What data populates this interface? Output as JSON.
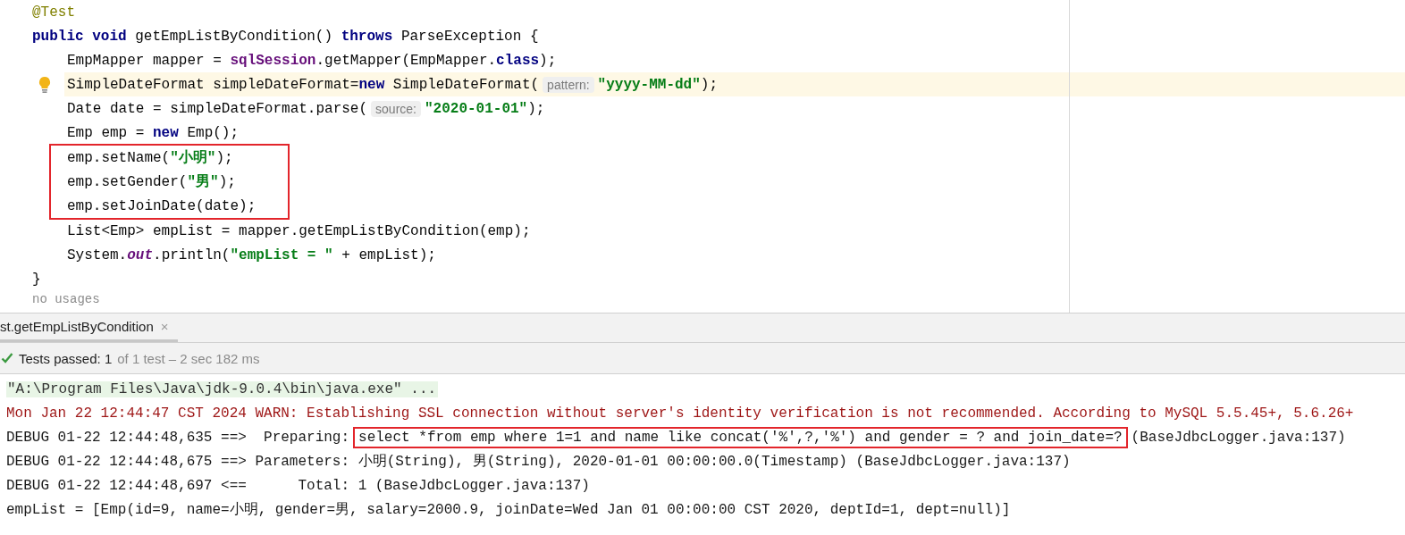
{
  "editor": {
    "lines": [
      {
        "segments": [
          {
            "kind": "annotation",
            "text": "@Test"
          }
        ]
      },
      {
        "segments": [
          {
            "kind": "keyword",
            "text": "public void "
          },
          {
            "kind": "plain",
            "text": "getEmpListByCondition() "
          },
          {
            "kind": "keyword",
            "text": "throws "
          },
          {
            "kind": "plain",
            "text": "ParseException {"
          }
        ],
        "children": [
          {
            "segments": [
              {
                "kind": "plain",
                "text": "EmpMapper mapper = "
              },
              {
                "kind": "field",
                "text": "sqlSession"
              },
              {
                "kind": "plain",
                "text": ".getMapper(EmpMapper."
              },
              {
                "kind": "keyword",
                "text": "class"
              },
              {
                "kind": "plain",
                "text": ");"
              }
            ]
          },
          {
            "current": true,
            "segments": [
              {
                "kind": "plain",
                "text": "SimpleDateFormat simpleDateFormat="
              },
              {
                "kind": "keyword",
                "text": "new "
              },
              {
                "kind": "plain",
                "text": "SimpleDateFormat("
              },
              {
                "kind": "hint",
                "text": "pattern:"
              },
              {
                "kind": "string",
                "text": "\"yyyy-MM-dd\""
              },
              {
                "kind": "plain",
                "text": ");"
              }
            ]
          },
          {
            "segments": [
              {
                "kind": "plain",
                "text": "Date date = simpleDateFormat.parse("
              },
              {
                "kind": "hint",
                "text": "source:"
              },
              {
                "kind": "string",
                "text": "\"2020-01-01\""
              },
              {
                "kind": "plain",
                "text": ");"
              }
            ]
          },
          {
            "segments": [
              {
                "kind": "plain",
                "text": "Emp emp = "
              },
              {
                "kind": "keyword",
                "text": "new "
              },
              {
                "kind": "plain",
                "text": "Emp();"
              }
            ]
          },
          {
            "kind": "boxed",
            "children": [
              {
                "segments": [
                  {
                    "kind": "plain",
                    "text": "emp.setName("
                  },
                  {
                    "kind": "string",
                    "text": "\"小明\""
                  },
                  {
                    "kind": "plain",
                    "text": ");"
                  }
                ]
              },
              {
                "segments": [
                  {
                    "kind": "plain",
                    "text": "emp.setGender("
                  },
                  {
                    "kind": "string",
                    "text": "\"男\""
                  },
                  {
                    "kind": "plain",
                    "text": ");"
                  }
                ]
              },
              {
                "segments": [
                  {
                    "kind": "plain",
                    "text": "emp.setJoinDate(date);"
                  }
                ]
              }
            ]
          },
          {
            "segments": [
              {
                "kind": "plain",
                "text": "List<Emp> empList = mapper.getEmpListByCondition(emp);"
              }
            ]
          },
          {
            "segments": [
              {
                "kind": "plain",
                "text": "System."
              },
              {
                "kind": "static",
                "text": "out"
              },
              {
                "kind": "plain",
                "text": ".println("
              },
              {
                "kind": "string",
                "text": "\"empList = \""
              },
              {
                "kind": "plain",
                "text": " + empList);"
              }
            ]
          }
        ]
      },
      {
        "segments": [
          {
            "kind": "plain",
            "text": "}"
          }
        ]
      }
    ],
    "usage_hint": "no usages"
  },
  "run_tabs": [
    {
      "label": "st.getEmpListByCondition",
      "close": "×",
      "selected": true
    }
  ],
  "status": {
    "label": "Tests passed: 1",
    "detail": "of 1 test – 2 sec 182 ms"
  },
  "console": [
    {
      "kind": "command",
      "segments": [
        {
          "text": "\"A:\\Program Files\\Java\\jdk-9.0.4\\bin\\java.exe\" ..."
        }
      ]
    },
    {
      "kind": "warn",
      "segments": [
        {
          "text": "Mon Jan 22 12:44:47 CST 2024 WARN: Establishing SSL connection without server's identity verification is not recommended. According to MySQL 5.5.45+, 5.6.26+"
        }
      ]
    },
    {
      "kind": "plain",
      "segments": [
        {
          "text": "DEBUG 01-22 12:44:48,635 ==>  Preparing:"
        },
        {
          "text": "select *from emp where 1=1 and name like concat('%',?,'%') and gender = ? and join_date=?",
          "boxed": true
        },
        {
          "text": "(BaseJdbcLogger.java:137)"
        }
      ]
    },
    {
      "kind": "plain",
      "segments": [
        {
          "text": "DEBUG 01-22 12:44:48,675 ==> Parameters: 小明(String), 男(String), 2020-01-01 00:00:00.0(Timestamp) (BaseJdbcLogger.java:137)"
        }
      ]
    },
    {
      "kind": "plain",
      "segments": [
        {
          "text": "DEBUG 01-22 12:44:48,697 <==      Total: 1 (BaseJdbcLogger.java:137)"
        }
      ]
    },
    {
      "kind": "plain",
      "segments": [
        {
          "text": "empList = [Emp(id=9, name=小明, gender=男, salary=2000.9, joinDate=Wed Jan 01 00:00:00 CST 2020, deptId=1, dept=null)]"
        }
      ]
    }
  ]
}
